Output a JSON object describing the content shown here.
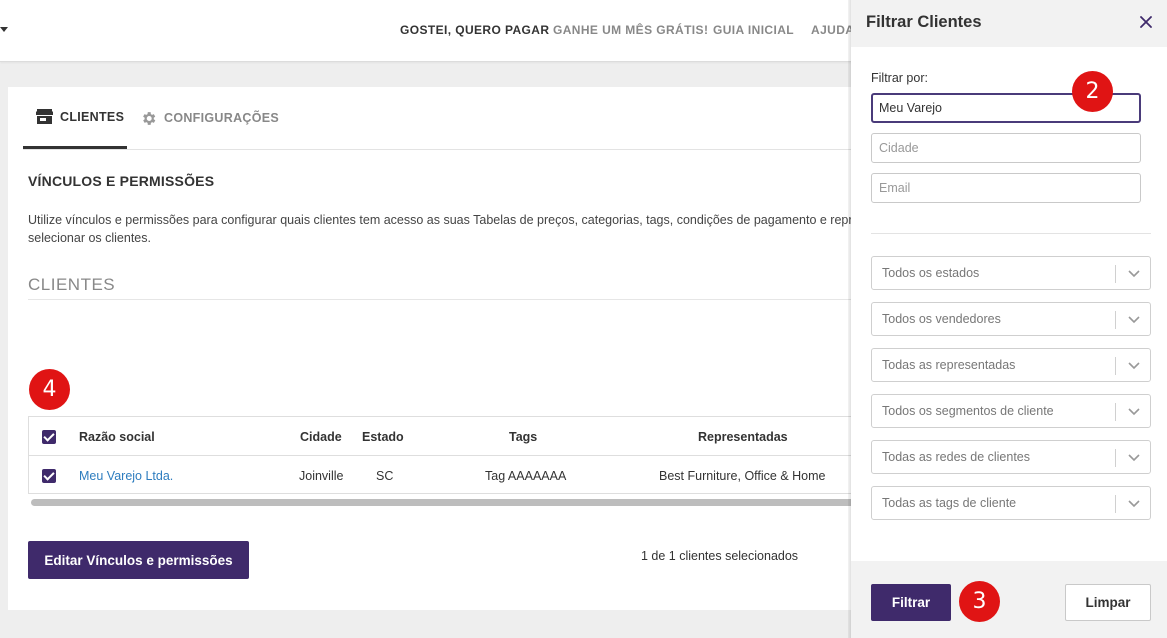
{
  "topnav": {
    "items": [
      "GOSTEI, QUERO PAGAR",
      "GANHE UM MÊS GRÁTIS!",
      "GUIA INICIAL",
      "AJUDA"
    ]
  },
  "tabs": [
    {
      "label": "CLIENTES",
      "icon": "store-icon",
      "active": true
    },
    {
      "label": "CONFIGURAÇÕES",
      "icon": "gear-icon",
      "active": false
    }
  ],
  "section": {
    "title": "VÍNCULOS E PERMISSÕES",
    "description_line1": "Utilize vínculos e permissões para configurar quais clientes tem acesso as suas Tabelas de preços, categorias, tags, condições de pagamento e repre",
    "description_line2": "selecionar os clientes."
  },
  "clients_heading": "CLIENTES",
  "table": {
    "columns": [
      "Razão social",
      "Cidade",
      "Estado",
      "Tags",
      "Representadas"
    ],
    "rows": [
      {
        "razao_social": "Meu Varejo Ltda.",
        "cidade": "Joinville",
        "estado": "SC",
        "tags": "Tag AAAAAAA",
        "representadas": "Best Furniture, Office & Home",
        "checked": true
      }
    ]
  },
  "actions": {
    "edit_button": "Editar Vínculos e permissões",
    "selection_count": "1 de 1 clientes selecionados"
  },
  "badges": {
    "b2": "2",
    "b3": "3",
    "b4": "4"
  },
  "panel": {
    "title": "Filtrar Clientes",
    "filter_label": "Filtrar por:",
    "name_value": "Meu Varejo",
    "city_placeholder": "Cidade",
    "email_placeholder": "Email",
    "selects": [
      "Todos os estados",
      "Todos os vendedores",
      "Todas as representadas",
      "Todos os segmentos de cliente",
      "Todas as redes de clientes",
      "Todas as tags de cliente"
    ],
    "filter_button": "Filtrar",
    "clear_button": "Limpar"
  },
  "colors": {
    "primary": "#3f2a6b",
    "badge": "#e01414",
    "link": "#2e7dbf"
  }
}
